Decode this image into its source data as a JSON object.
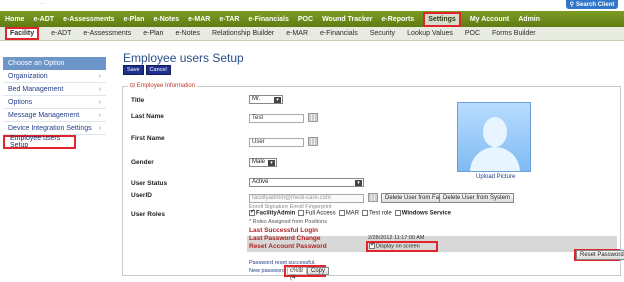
{
  "header": {
    "logo_text": "...",
    "search_label": "Search Client"
  },
  "mainnav": [
    "Home",
    "e-ADT",
    "e-Assessments",
    "e-Plan",
    "e-Notes",
    "e-MAR",
    "e-TAR",
    "e-Financials",
    "POC",
    "Wound Tracker",
    "e-Reports",
    "Settings",
    "My Account",
    "Admin"
  ],
  "mainnav_active": "Settings",
  "subnav": [
    "Facility",
    "e-ADT",
    "e-Assessments",
    "e-Plan",
    "e-Notes",
    "Relationship Builder",
    "e-MAR",
    "e-Financials",
    "Security",
    "Lookup Values",
    "POC",
    "Forms Builder"
  ],
  "subnav_active": "Facility",
  "sidebar": {
    "header": "Choose an Option",
    "items": [
      {
        "label": "Organization",
        "arrow": "›"
      },
      {
        "label": "Bed Management",
        "arrow": "›"
      },
      {
        "label": "Options",
        "arrow": "›"
      },
      {
        "label": "Message Management",
        "arrow": "›"
      },
      {
        "label": "Device Integration Settings",
        "arrow": "›"
      },
      {
        "label": "Employee users Setup",
        "arrow": ""
      }
    ]
  },
  "page": {
    "title": "Employee users Setup",
    "save": "Save",
    "cancel": "Cancel"
  },
  "form": {
    "legend": "⊟ Employee Information",
    "title_label": "Title",
    "title_value": "Mr.",
    "last_name_label": "Last Name",
    "last_name_value": "Test",
    "first_name_label": "First Name",
    "first_name_value": "User",
    "gender_label": "Gender",
    "gender_value": "Male",
    "user_status_label": "User Status",
    "user_status_value": "Active",
    "userid_label": "UserID",
    "userid_value": "facilityadmin@medi-care.com",
    "delete_facility": "Delete User from Facility",
    "delete_system": "Delete User from System",
    "enroll_hint": "Enroll Signature  Enroll Fingerprint",
    "user_roles_label": "User Roles",
    "roles": [
      {
        "label": "FacilityAdmin",
        "checked": true,
        "bold": true
      },
      {
        "label": "Full Access",
        "checked": false,
        "bold": false
      },
      {
        "label": "MAR",
        "checked": false,
        "bold": false
      },
      {
        "label": "Test role",
        "checked": false,
        "bold": false
      },
      {
        "label": "Windows Service",
        "checked": false,
        "bold": true
      }
    ],
    "roles_note": "* Roles Assigned from Positions",
    "last_login_label": "Last Successful Login",
    "last_pw_change_label": "Last Password Change",
    "last_pw_change_value": "2/28/2012 11:17:00 AM",
    "reset_pw_label": "Reset Account Password",
    "display_on_screen": "Display on screen",
    "reset_button": "Reset Password",
    "reset_msg": "Password reset successful.",
    "new_pw_label": "New password:",
    "new_pw_value": "c%$!(4",
    "copy_label": "Copy",
    "upload_picture": "Upload Picture"
  }
}
